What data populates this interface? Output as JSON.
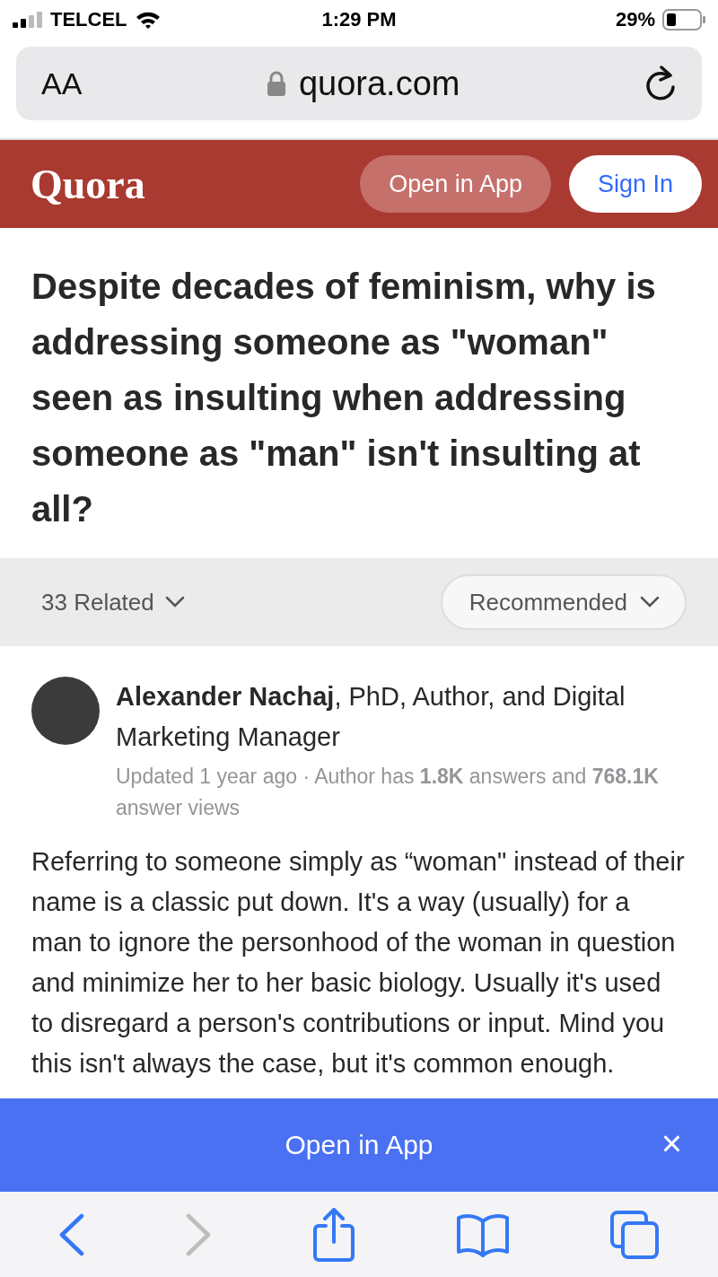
{
  "status_bar": {
    "carrier": "TELCEL",
    "time": "1:29 PM",
    "battery": "29%"
  },
  "address_bar": {
    "text_size": "AA",
    "url": "quora.com"
  },
  "header": {
    "logo": "Quora",
    "open_in_app": "Open in App",
    "sign_in": "Sign In"
  },
  "question": {
    "title": "Despite decades of feminism, why is addressing someone as \"woman\" seen as insulting when addressing someone as \"man\" isn't insulting at all?"
  },
  "filters": {
    "related": "33 Related",
    "sort": "Recommended"
  },
  "answer": {
    "author": "**Alexander Nachaj**, PhD, Author, and Digital Marketing Manager",
    "meta": "Updated 1 year ago · Author has **1.8K** answers and **768.1K** answer views",
    "body": "Referring to someone simply as “woman\" instead of their name is a classic put down. It's a way (usually) for a man to ignore the personhood of the woman in question and minimize her to her basic biology. Usually it's used to disregard a person's contributions or input. Mind you this isn't always the case, but it's common enough."
  },
  "banner": {
    "label": "Open in App",
    "close": "×"
  },
  "toolbar": {
    "back_disabled": false,
    "forward_disabled": true
  }
}
